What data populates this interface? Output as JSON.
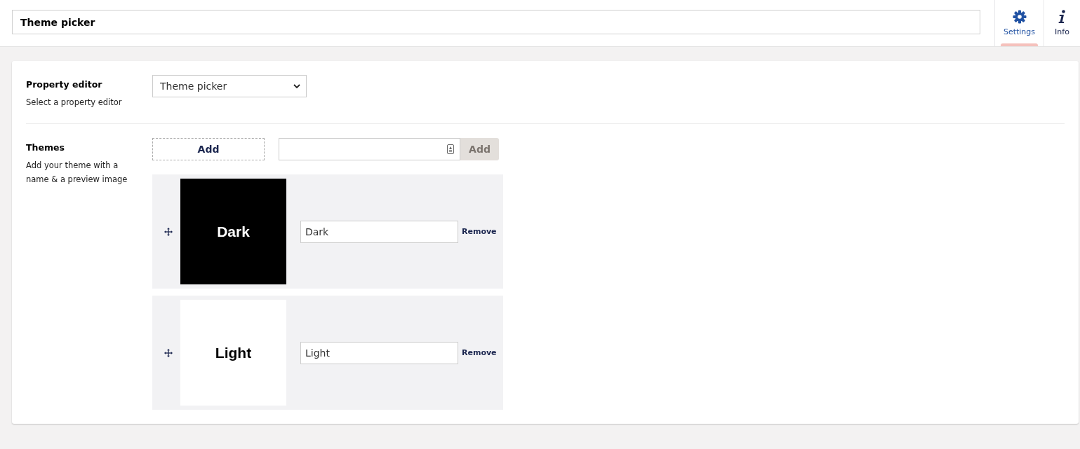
{
  "header": {
    "name_field": {
      "value": "Theme picker"
    },
    "tabs": [
      {
        "label": "Settings",
        "kind": "settings",
        "selected": true
      },
      {
        "label": "Info",
        "kind": "info",
        "selected": false
      }
    ]
  },
  "properties": [
    {
      "kind": "select",
      "label": "Property editor",
      "description": "Select a property editor",
      "value": "Theme picker"
    },
    {
      "kind": "themes",
      "label": "Themes",
      "description": "Add your theme with a name & a preview image",
      "add_button": "Add",
      "submit_button": {
        "label": "Add",
        "disabled": true
      },
      "themes": [
        {
          "preview": {
            "text": "Dark",
            "kind": "dark"
          },
          "name": "Dark",
          "remove": "Remove"
        },
        {
          "preview": {
            "text": "Light",
            "kind": "light"
          },
          "name": "Light",
          "remove": "Remove"
        }
      ]
    }
  ]
}
